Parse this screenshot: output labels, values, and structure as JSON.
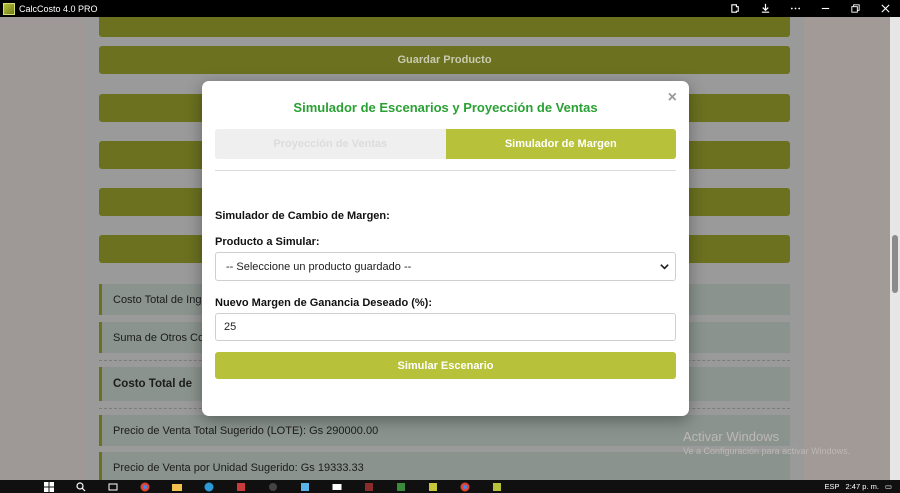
{
  "window": {
    "title": "CalcCosto 4.0 PRO"
  },
  "background": {
    "save_product": "Guardar Producto",
    "info_rows": [
      "Costo Total de Ing",
      "Suma de Otros Co",
      "Costo Total de"
    ],
    "price_total": "Precio de Venta Total Sugerido (LOTE): Gs 290000.00",
    "price_unit": "Precio de Venta por Unidad Sugerido: Gs 19333.33"
  },
  "modal": {
    "title": "Simulador de Escenarios y Proyección de Ventas",
    "close": "×",
    "tabs": [
      {
        "label": "Proyección de Ventas",
        "active": false
      },
      {
        "label": "Simulador de Margen",
        "active": true
      }
    ],
    "section_title": "Simulador de Cambio de Margen:",
    "product_label": "Producto a Simular:",
    "product_select_value": "-- Seleccione un producto guardado --",
    "margin_label": "Nuevo Margen de Ganancia Deseado (%):",
    "margin_value": "25",
    "simulate_button": "Simular Escenario"
  },
  "watermark": {
    "line1": "Activar Windows",
    "line2": "Ve a Configuración para activar Windows."
  },
  "taskbar": {
    "lang": "ESP",
    "time": "2:47 p. m."
  },
  "colors": {
    "accent": "#b7c23a",
    "title_green": "#2aa134"
  }
}
